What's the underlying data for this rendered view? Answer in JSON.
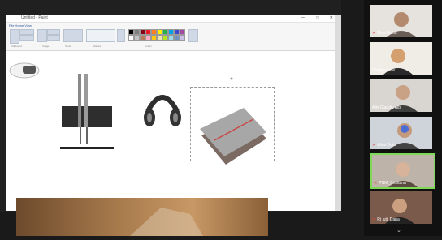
{
  "app": {
    "title": "Untitled - Paint",
    "menu": "File  Home  View"
  },
  "window_controls": "— □ ✕",
  "ribbon_groups": [
    "Clipboard",
    "Image",
    "Tools",
    "Shapes",
    "Colors"
  ],
  "palette": [
    "#000000",
    "#7f7f7f",
    "#880015",
    "#ed1c24",
    "#ff7f27",
    "#fff200",
    "#22b14c",
    "#00a2e8",
    "#3f48cc",
    "#a349a4",
    "#ffffff",
    "#c3c3c3",
    "#b97a57",
    "#ffaec9",
    "#ffc90e",
    "#efe4b0",
    "#b5e61d",
    "#99d9ea",
    "#7092be",
    "#c8bfe7"
  ],
  "participants": [
    {
      "name": "Titus Matei",
      "muted": true
    },
    {
      "name": "Cristina Ione",
      "muted": false
    },
    {
      "name": "Alin Claudiu Alb",
      "muted": false
    },
    {
      "name": "Alica Dutu",
      "muted": true
    },
    {
      "name": "PNM_Cristiana",
      "muted": true,
      "active": true
    },
    {
      "name": "Ri_uti_Dana",
      "muted": true
    }
  ],
  "scroll_more_icon": "chevron-down-icon"
}
